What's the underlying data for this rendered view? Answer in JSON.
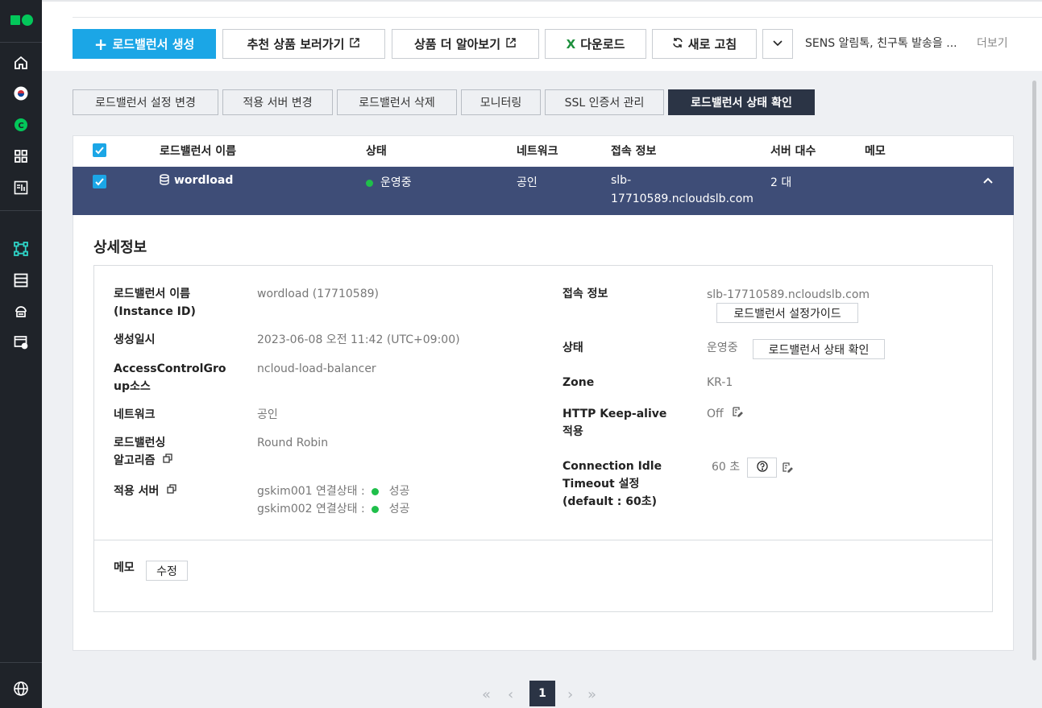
{
  "toolbar": {
    "create_label": "로드밸런서 생성",
    "recommend_label": "추천 상품 보러가기",
    "learn_label": "상품 더 알아보기",
    "download_label": "다운로드",
    "refresh_label": "새로 고침",
    "notice": "SENS 알림톡, 친구톡 발송을 ...",
    "more_label": "더보기"
  },
  "actions": {
    "settings": "로드밸런서 설정 변경",
    "servers": "적용 서버 변경",
    "delete": "로드밸런서 삭제",
    "monitoring": "모니터링",
    "ssl": "SSL 인증서 관리",
    "status_check": "로드밸런서 상태 확인"
  },
  "table": {
    "headers": {
      "name": "로드밸런서 이름",
      "status": "상태",
      "network": "네트워크",
      "access": "접속 정보",
      "servers": "서버 대수",
      "memo": "메모"
    },
    "row": {
      "name": "wordload",
      "status": "운영중",
      "network": "공인",
      "access_line1": "slb-",
      "access_line2": "17710589.ncloudslb.com",
      "servers": "2 대"
    }
  },
  "detail": {
    "title": "상세정보",
    "name_label_1": "로드밸런서 이름",
    "name_label_2": "(Instance ID)",
    "name_value": "wordload (17710589)",
    "created_label": "생성일시",
    "created_value": "2023-06-08 오전 11:42 (UTC+09:00)",
    "acg_label_1": "AccessControlGro",
    "acg_label_2": "up소스",
    "acg_value": "ncloud-load-balancer",
    "network_label": "네트워크",
    "network_value": "공인",
    "algo_label_1": "로드밸런싱",
    "algo_label_2": "알고리즘",
    "algo_value": "Round Robin",
    "servers_label": "적용 서버",
    "server1": "gskim001 연결상태 :",
    "server1_state": "성공",
    "server2": "gskim002 연결상태 :",
    "server2_state": "성공",
    "access_label": "접속 정보",
    "access_value": "slb-17710589.ncloudslb.com",
    "guide_button": "로드밸런서 설정가이드",
    "status_label": "상태",
    "status_value": "운영중",
    "status_button": "로드밸런서 상태 확인",
    "zone_label": "Zone",
    "zone_value": "KR-1",
    "keepalive_label_1": "HTTP Keep-alive",
    "keepalive_label_2": "적용",
    "keepalive_value": "Off",
    "idle_label_1": "Connection Idle",
    "idle_label_2": "Timeout 설정",
    "idle_label_3": "(default : 60초)",
    "idle_value": "60 초",
    "memo_label": "메모",
    "memo_button": "수정"
  },
  "pagination": {
    "current": "1"
  },
  "colors": {
    "primary": "#1ba6e6",
    "sidebar": "#1f2329",
    "selected_row": "#3e4d77",
    "dark_button": "#2b3445",
    "status_green": "#1fbf4a"
  }
}
